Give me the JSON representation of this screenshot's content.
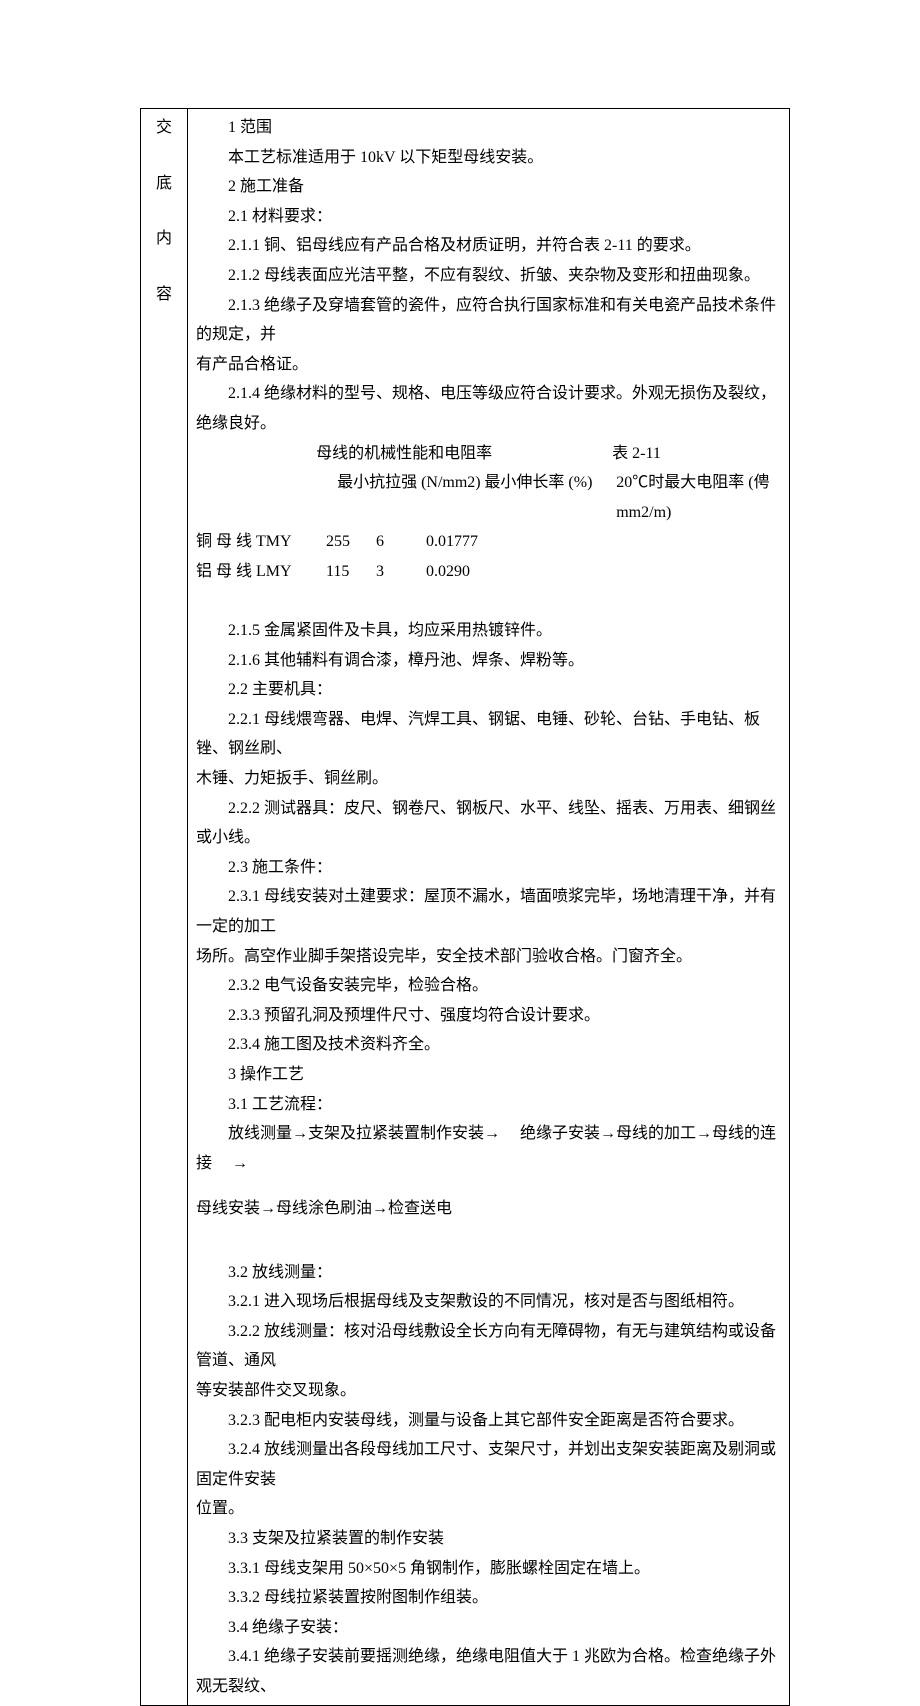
{
  "side": {
    "c1": "交",
    "c2": "底",
    "c3": "内",
    "c4": "容"
  },
  "lines": {
    "l1": "1   范围",
    "l2": "本工艺标准适用于 10kV 以下矩型母线安装。",
    "l3": "2   施工准备",
    "l4": "2.1   材料要求：",
    "l5": "2.1.1   铜、铝母线应有产品合格及材质证明，并符合表 2-11 的要求。",
    "l6": "2.1.2   母线表面应光洁平整，不应有裂纹、折皱、夹杂物及变形和扭曲现象。",
    "l7": "2.1.3   绝缘子及穿墙套管的瓷件，应符合执行国家标准和有关电瓷产品技术条件的规定，并",
    "l7b": "有产品合格证。",
    "l8": "2.1.4   绝缘材料的型号、规格、电压等级应符合设计要求。外观无损伤及裂纹，绝缘良好。",
    "tbl_title_l": "母线的机械性能和电阻率",
    "tbl_title_r": "表 2-11",
    "th2": "最小抗拉强 (N/mm2)",
    "th3": "最小伸长率 (%)",
    "th4": "20℃时最大电阻率 (俜 mm2/m)",
    "r1c1": "铜 母 线 TMY",
    "r1c2": "255",
    "r1c3": "6",
    "r1c4": "0.01777",
    "r2c1": "铝 母 线 LMY",
    "r2c2": "115",
    "r2c3": "3",
    "r2c4": "0.0290",
    "l9": "2.1.5   金属紧固件及卡具，均应采用热镀锌件。",
    "l10": "2.1.6   其他辅料有调合漆，樟丹池、焊条、焊粉等。",
    "l11": "2.2   主要机具：",
    "l12": "2.2.1   母线煨弯器、电焊、汽焊工具、钢锯、电锤、砂轮、台钻、手电钻、板锉、钢丝刷、",
    "l12b": "木锤、力矩扳手、铜丝刷。",
    "l13": "2.2.2   测试器具：皮尺、钢卷尺、钢板尺、水平、线坠、摇表、万用表、细钢丝或小线。",
    "l14": "2.3   施工条件：",
    "l15": "2.3.1   母线安装对土建要求：屋顶不漏水，墙面喷浆完毕，场地清理干净，并有一定的加工",
    "l15b": "场所。高空作业脚手架搭设完毕，安全技术部门验收合格。门窗齐全。",
    "l16": "2.3.2   电气设备安装完毕，检验合格。",
    "l17": "2.3.3   预留孔洞及预埋件尺寸、强度均符合设计要求。",
    "l18": "2.3.4   施工图及技术资料齐全。",
    "l19": "3   操作工艺",
    "l20": "3.1   工艺流程：",
    "flow1a": " 放线测量→支架及拉紧装置制作安装→",
    "flow1b": "绝缘子安装→母线的加工→母线的连接",
    "flow1c": "→",
    "flow2": "母线安装→母线涂色刷油→检查送电",
    "l21": "3.2   放线测量：",
    "l22": "3.2.1   进入现场后根据母线及支架敷设的不同情况，核对是否与图纸相符。",
    "l23": "3.2.2   放线测量：核对沿母线敷设全长方向有无障碍物，有无与建筑结构或设备管道、通风",
    "l23b": "等安装部件交叉现象。",
    "l24": "3.2.3   配电柜内安装母线，测量与设备上其它部件安全距离是否符合要求。",
    "l25": "3.2.4   放线测量出各段母线加工尺寸、支架尺寸，并划出支架安装距离及剔洞或固定件安装",
    "l25b": "位置。",
    "l26": "3.3   支架及拉紧装置的制作安装",
    "l27": "3.3.1   母线支架用 50×50×5 角钢制作，膨胀螺栓固定在墙上。",
    "l28": "3.3.2   母线拉紧装置按附图制作组装。",
    "l29": "3.4   绝缘子安装：",
    "l30": "3.4.1   绝缘子安装前要摇测绝缘，绝缘电阻值大于 1 兆欧为合格。检查绝缘子外观无裂纹、"
  }
}
